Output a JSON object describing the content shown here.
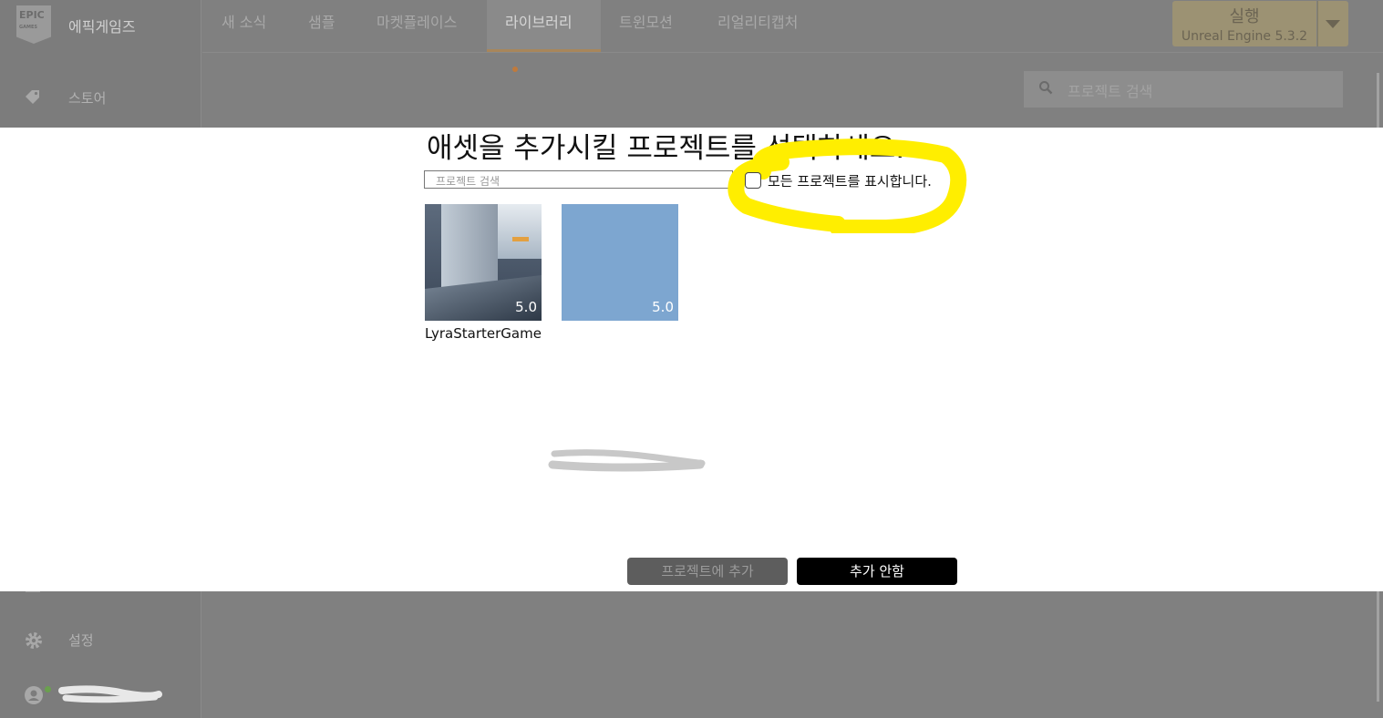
{
  "app": {
    "brand": "에픽게임즈",
    "logo_text": "EPIC GAMES"
  },
  "sidebar": {
    "store_label": "스토어",
    "settings_label": "설정"
  },
  "tabs": [
    {
      "label": "새 소식"
    },
    {
      "label": "샘플"
    },
    {
      "label": "마켓플레이스"
    },
    {
      "label": "라이브러리",
      "active": true
    },
    {
      "label": "트윈모션"
    },
    {
      "label": "리얼리티캡처"
    }
  ],
  "launch": {
    "label": "실행",
    "version": "Unreal Engine 5.3.2"
  },
  "top_search": {
    "placeholder": "프로젝트 검색"
  },
  "dialog": {
    "title": "애셋을 추가시킬 프로젝트를 선택하세요.",
    "search_placeholder": "프로젝트 검색",
    "show_all_label": "모든 프로젝트를 표시합니다.",
    "show_all_checked": false,
    "projects": [
      {
        "name": "LyraStarterGame",
        "version": "5.0"
      },
      {
        "name": "",
        "version": "5.0"
      }
    ],
    "add_button": "프로젝트에 추가",
    "cancel_button": "추가 안함"
  },
  "colors": {
    "overlay": "#808080",
    "highlight": "#ffee00",
    "launch_bg": "#9c9273",
    "active_tab_underline": "#a8865a"
  }
}
